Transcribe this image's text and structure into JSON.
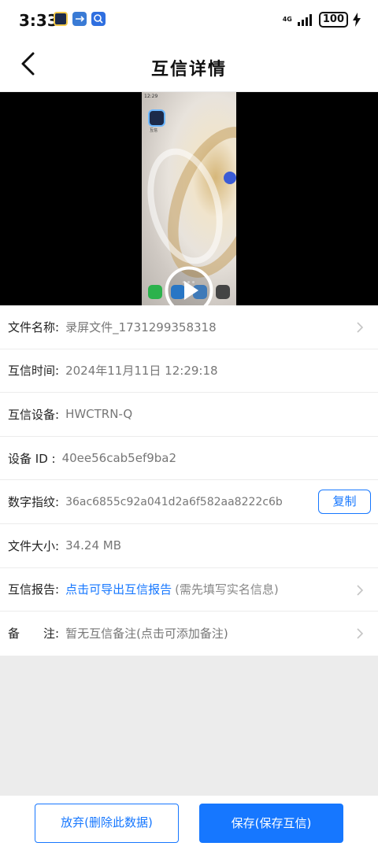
{
  "status_bar": {
    "time": "3:33",
    "network": "4G",
    "battery": "100",
    "app_icons": [
      "app-logo-icon",
      "usb-icon",
      "app-search-icon"
    ]
  },
  "header": {
    "title": "互信详情"
  },
  "video": {
    "screen_time": "12:29",
    "app_label": "互信",
    "accent_color": "#1677ff"
  },
  "details": {
    "file_name_label": "文件名称:",
    "file_name_value": "录屏文件_1731299358318",
    "time_label": "互信时间:",
    "time_value": "2024年11月11日 12:29:18",
    "device_label": "互信设备:",
    "device_value": "HWCTRN-Q",
    "device_id_label": "设备 ID :",
    "device_id_value": "40ee56cab5ef9ba2",
    "fingerprint_label": "数字指纹:",
    "fingerprint_value": "36ac6855c92a041d2a6f582aa8222c6b",
    "copy_label": "复制",
    "size_label": "文件大小:",
    "size_value": "34.24 MB",
    "report_label": "互信报告:",
    "report_link": "点击可导出互信报告",
    "report_hint": "(需先填写实名信息)",
    "remark_label": "备　　注:",
    "remark_value": "暂无互信备注(点击可添加备注)"
  },
  "actions": {
    "discard_label": "放弃(删除此数据)",
    "save_label": "保存(保存互信)"
  }
}
